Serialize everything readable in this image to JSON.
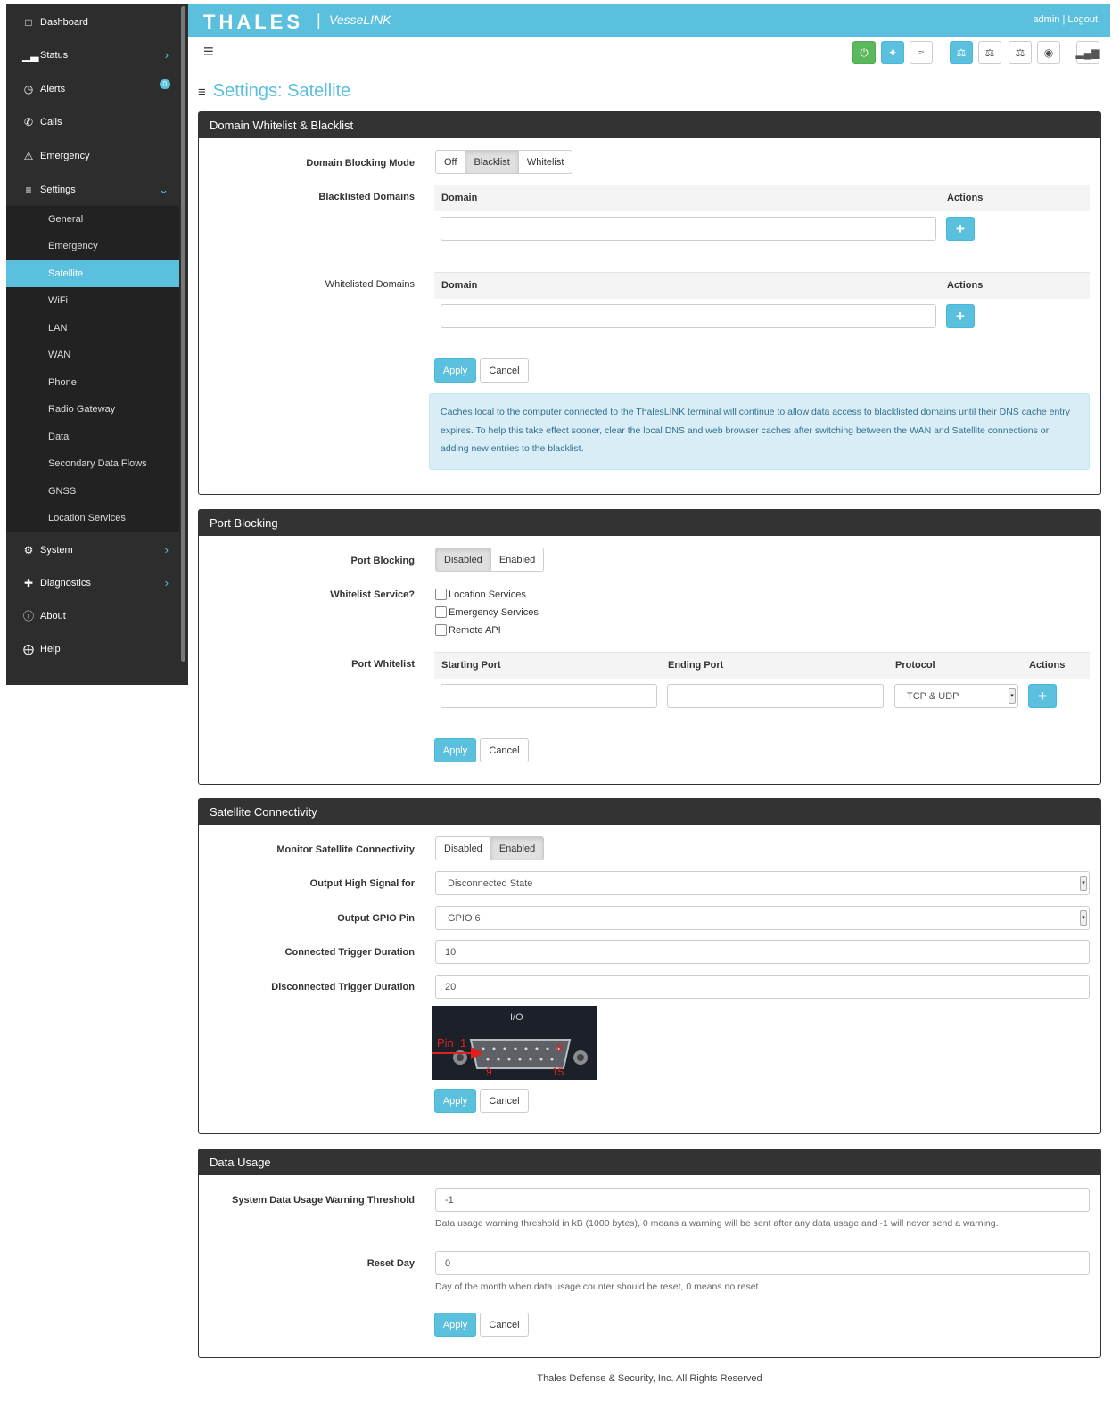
{
  "sidebar": {
    "items": [
      {
        "label": "Dashboard",
        "icon": "monitor-icon"
      },
      {
        "label": "Status",
        "icon": "bar-chart-icon"
      },
      {
        "label": "Alerts",
        "icon": "alarm-clock-icon",
        "badge": "0"
      },
      {
        "label": "Calls",
        "icon": "phone-icon"
      },
      {
        "label": "Emergency",
        "icon": "warning-icon"
      },
      {
        "label": "Settings",
        "icon": "sliders-icon"
      },
      {
        "label": "System",
        "icon": "gear-icon"
      },
      {
        "label": "Diagnostics",
        "icon": "medkit-icon"
      },
      {
        "label": "About",
        "icon": "info-icon"
      },
      {
        "label": "Help",
        "icon": "lifebuoy-icon"
      }
    ],
    "settings_sub": [
      "General",
      "Emergency",
      "Satellite",
      "WiFi",
      "LAN",
      "WAN",
      "Phone",
      "Radio Gateway",
      "Data",
      "Secondary Data Flows",
      "GNSS",
      "Location Services"
    ],
    "active_sub": "Satellite"
  },
  "header": {
    "brand": "THALES",
    "separator": "|",
    "product": "VesseLINK",
    "user_links": "admin | Logout",
    "accent": "#5bc0de"
  },
  "toolbar_icons": [
    "power-icon",
    "satellite-icon",
    "wifi-icon",
    "network-icon",
    "network-icon",
    "network-icon",
    "globe-icon",
    "signal-icon"
  ],
  "page": {
    "title": "Settings: Satellite",
    "icon": "sliders-icon"
  },
  "domain_panel": {
    "title": "Domain Whitelist & Blacklist",
    "mode_label": "Domain Blocking Mode",
    "mode_options": [
      "Off",
      "Blacklist",
      "Whitelist"
    ],
    "mode_selected": "Blacklist",
    "blacklisted_label": "Blacklisted Domains",
    "whitelisted_label": "Whitelisted Domains",
    "col_domain": "Domain",
    "col_actions": "Actions",
    "plus": "+",
    "apply": "Apply",
    "cancel": "Cancel",
    "info": "Caches local to the computer connected to the ThalesLINK terminal will continue to allow data access to blacklisted domains until their DNS cache entry expires. To help this take effect sooner, clear the local DNS and web browser caches after switching between the WAN and Satellite connections or adding new entries to the blacklist."
  },
  "port_panel": {
    "title": "Port Blocking",
    "blocking_label": "Port Blocking",
    "blocking_options": [
      "Disabled",
      "Enabled"
    ],
    "blocking_selected": "Disabled",
    "whitelist_service_label": "Whitelist Service?",
    "services": [
      "Location Services",
      "Emergency Services",
      "Remote API"
    ],
    "port_whitelist_label": "Port Whitelist",
    "col_start": "Starting Port",
    "col_end": "Ending Port",
    "col_protocol": "Protocol",
    "col_actions": "Actions",
    "protocol_value": "TCP & UDP",
    "plus": "+",
    "apply": "Apply",
    "cancel": "Cancel"
  },
  "sat_panel": {
    "title": "Satellite Connectivity",
    "monitor_label": "Monitor Satellite Connectivity",
    "monitor_options": [
      "Disabled",
      "Enabled"
    ],
    "monitor_selected": "Enabled",
    "output_signal_label": "Output High Signal for",
    "output_signal_value": "Disconnected State",
    "gpio_label": "Output GPIO Pin",
    "gpio_value": "GPIO 6",
    "connected_label": "Connected Trigger Duration",
    "connected_value": "10",
    "disconnected_label": "Disconnected Trigger Duration",
    "disconnected_value": "20",
    "io_caption": "I/O",
    "pin_label": "Pin",
    "pin_nums": [
      "1",
      "8",
      "9",
      "15"
    ],
    "apply": "Apply",
    "cancel": "Cancel"
  },
  "data_panel": {
    "title": "Data Usage",
    "threshold_label": "System Data Usage Warning Threshold",
    "threshold_value": "-1",
    "threshold_help": "Data usage warning threshold in kB (1000 bytes), 0 means a warning will be sent after any data usage and -1 will never send a warning.",
    "reset_label": "Reset Day",
    "reset_value": "0",
    "reset_help": "Day of the month when data usage counter should be reset, 0 means no reset.",
    "apply": "Apply",
    "cancel": "Cancel"
  },
  "footer": "Thales Defense & Security, Inc. All Rights Reserved"
}
